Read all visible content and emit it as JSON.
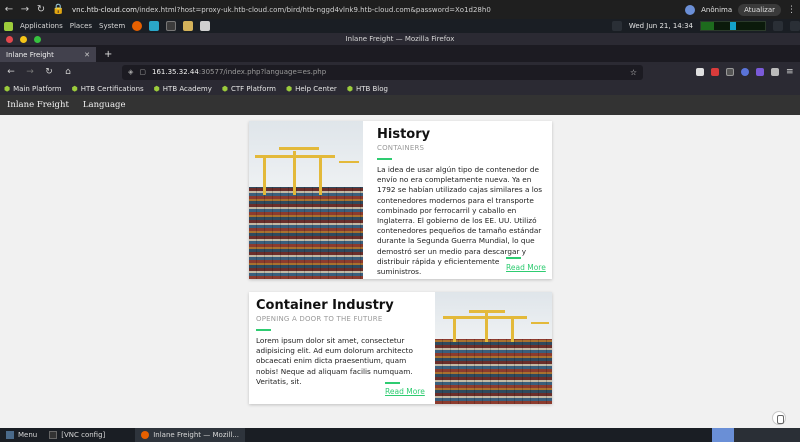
{
  "host": {
    "url_prefix": "vnc.htb-cloud.com",
    "url_rest": "/index.html?host=proxy-uk.htb-cloud.com/bird/htb-nggd4vlnk9.htb-cloud.com&password=Xo1d28h0",
    "profile": "Anônima",
    "update_button": "Atualizar"
  },
  "desktop": {
    "menu": [
      "Applications",
      "Places",
      "System"
    ],
    "clock": "Wed Jun 21, 14:34"
  },
  "firefox": {
    "window_title": "Inlane Freight — Mozilla Firefox",
    "tab_title": "Inlane Freight",
    "url_host": "161.35.32.44",
    "url_path": ":30577/index.php?language=es.php"
  },
  "bookmarks": [
    "Main Platform",
    "HTB Certifications",
    "HTB Academy",
    "CTF Platform",
    "Help Center",
    "HTB Blog"
  ],
  "site_nav": [
    "Inlane Freight",
    "Language"
  ],
  "cards": [
    {
      "title": "History",
      "subtitle": "CONTAINERS",
      "text": "La idea de usar algún tipo de contenedor de envío no era completamente nueva. Ya en 1792 se habían utilizado cajas similares a los contenedores modernos para el transporte combinado por ferrocarril y caballo en Inglaterra. El gobierno de los EE. UU. Utilizó contenedores pequeños de tamaño estándar durante la Segunda Guerra Mundial, lo que demostró ser un medio para descargar y distribuir rápida y eficientemente suministros.",
      "link": "Read More"
    },
    {
      "title": "Container Industry",
      "subtitle": "OPENING A DOOR TO THE FUTURE",
      "text": "Lorem ipsum dolor sit amet, consectetur adipisicing elit. Ad eum dolorum architecto obcaecati enim dicta praesentium, quam nobis! Neque ad aliquam facilis numquam. Veritatis, sit.",
      "link": "Read More"
    }
  ],
  "taskbar": {
    "menu": "Menu",
    "vnc": "[VNC config]",
    "window": "Inlane Freight — Mozill..."
  },
  "colors": {
    "accent": "#2ecc71",
    "site_nav_bg": "#333333",
    "page_bg": "#f1f1f1"
  }
}
